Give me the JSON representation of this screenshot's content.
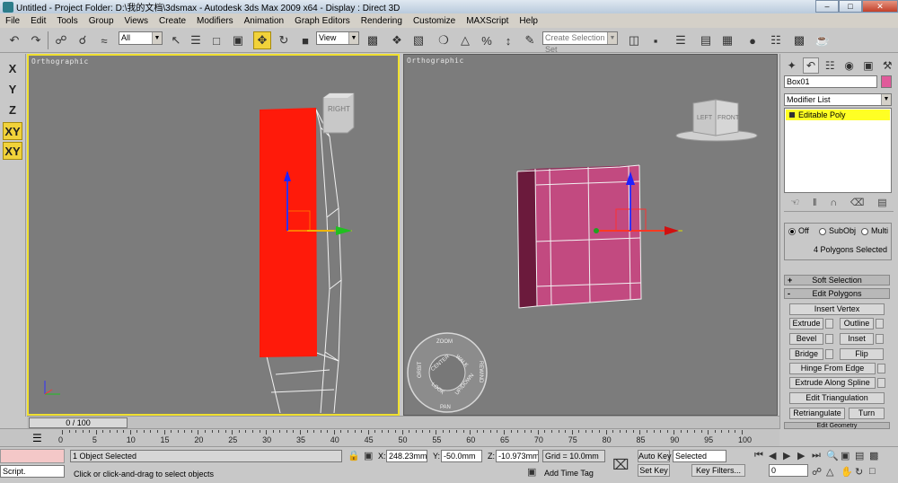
{
  "window": {
    "title": "Untitled    - Project Folder: D:\\我的文档\\3dsmax    - Autodesk 3ds Max  2009 x64    - Display : Direct 3D"
  },
  "menu": [
    "File",
    "Edit",
    "Tools",
    "Group",
    "Views",
    "Create",
    "Modifiers",
    "Animation",
    "Graph Editors",
    "Rendering",
    "Customize",
    "MAXScript",
    "Help"
  ],
  "toolbar": {
    "selection_filter": "All",
    "ref_coord": "View",
    "named_selection_placeholder": "Create Selection Set"
  },
  "axis_buttons": [
    "X",
    "Y",
    "Z",
    "XY",
    "XY"
  ],
  "viewports": {
    "left": {
      "label": "Orthographic",
      "viewcube_label": "RIGHT"
    },
    "right": {
      "label": "Orthographic",
      "viewcube_left": "LEFT",
      "viewcube_front": "FRONT"
    }
  },
  "steering_wheel": [
    "ZOOM",
    "ORBIT",
    "CENTER",
    "WALK",
    "REWIND",
    "LOOK",
    "UP/DOWN",
    "PAN"
  ],
  "command_panel": {
    "object_name": "Box01",
    "object_color": "#e05a9a",
    "modifier_list": "Modifier List",
    "stack": [
      "Editable Poly"
    ],
    "preview": {
      "off": "Off",
      "subobj": "SubObj",
      "multi": "Multi"
    },
    "polygons_selected": "4 Polygons Selected",
    "soft_selection": "Soft Selection",
    "edit_polygons": "Edit Polygons",
    "buttons": {
      "insert_vertex": "Insert Vertex",
      "extrude": "Extrude",
      "outline": "Outline",
      "bevel": "Bevel",
      "inset": "Inset",
      "bridge": "Bridge",
      "flip": "Flip",
      "hinge_from_edge": "Hinge From Edge",
      "extrude_along_spline": "Extrude Along Spline",
      "edit_triangulation": "Edit Triangulation",
      "retriangulate": "Retriangulate",
      "turn": "Turn",
      "edit_geometry": "Edit Geometry"
    }
  },
  "timeline": {
    "slider": "0 / 100",
    "ticks": [
      "0",
      "5",
      "10",
      "15",
      "20",
      "25",
      "30",
      "35",
      "40",
      "45",
      "50",
      "55",
      "60",
      "65",
      "70",
      "75",
      "80",
      "85",
      "90",
      "95",
      "100"
    ]
  },
  "status": {
    "script": "Script.",
    "selection": "1 Object Selected",
    "prompt": "Click or click-and-drag to select objects",
    "x_label": "X:",
    "x_value": "248.23mm",
    "y_label": "Y:",
    "y_value": "-50.0mm",
    "z_label": "Z:",
    "z_value": "-10.973mm",
    "grid": "Grid = 10.0mm",
    "add_time_tag": "Add Time Tag",
    "auto_key": "Auto Key",
    "set_key": "Set Key",
    "key_mode": "Selected",
    "key_filters": "Key Filters...",
    "frame": "0"
  },
  "colors": {
    "viewport_bg": "#7c7c7c",
    "active_border": "#f0e030",
    "red_object": "#ff1a0a",
    "pink_object": "#c24a80",
    "selected_stack": "#ffff24"
  }
}
